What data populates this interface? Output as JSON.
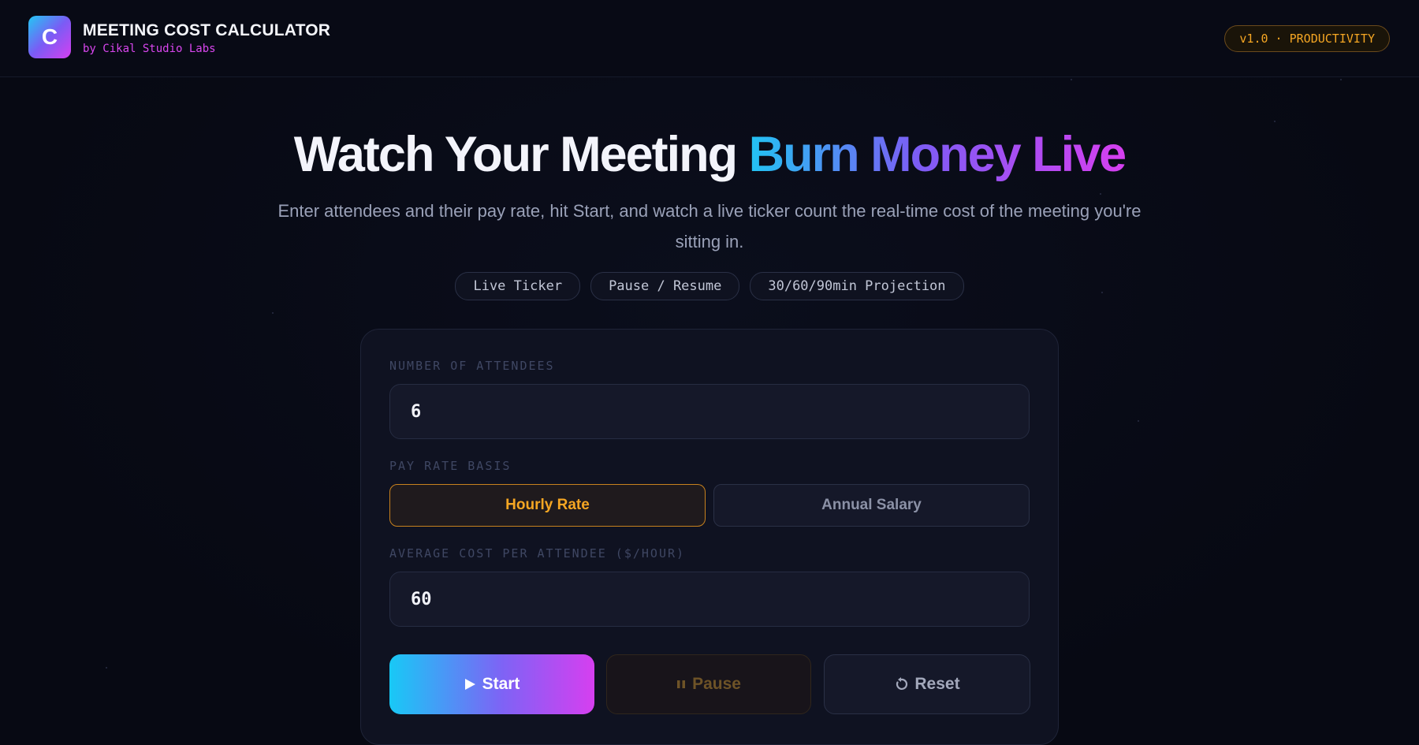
{
  "header": {
    "logo_letter": "C",
    "title": "MEETING COST CALCULATOR",
    "subtitle": "by Cikal Studio Labs",
    "version_badge": "v1.0 · PRODUCTIVITY"
  },
  "hero": {
    "title_plain": "Watch Your Meeting ",
    "title_gradient": "Burn Money Live",
    "subtitle": "Enter attendees and their pay rate, hit Start, and watch a live ticker count the real-time cost of the meeting you're sitting in.",
    "chips": [
      "Live Ticker",
      "Pause / Resume",
      "30/60/90min Projection"
    ]
  },
  "form": {
    "attendees_label": "NUMBER OF ATTENDEES",
    "attendees_value": "6",
    "pay_basis_label": "PAY RATE BASIS",
    "pay_basis_options": [
      "Hourly Rate",
      "Annual Salary"
    ],
    "pay_basis_selected": "Hourly Rate",
    "cost_label": "AVERAGE COST PER ATTENDEE ($/HOUR)",
    "cost_value": "60",
    "start_label": "Start",
    "pause_label": "Pause",
    "reset_label": "Reset"
  },
  "colors": {
    "accent_orange": "#f5a623",
    "accent_magenta": "#d946ef",
    "accent_cyan": "#22c3f3",
    "background": "#070913"
  },
  "icons": {
    "start": "play-icon",
    "pause": "pause-icon",
    "reset": "reset-icon"
  }
}
